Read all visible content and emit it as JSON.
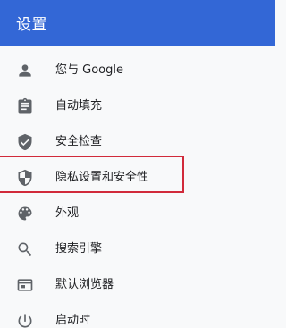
{
  "header": {
    "title": "设置"
  },
  "menu": {
    "items": [
      {
        "label": "您与 Google",
        "icon": "person-icon"
      },
      {
        "label": "自动填充",
        "icon": "clipboard-icon"
      },
      {
        "label": "安全检查",
        "icon": "shield-check-icon"
      },
      {
        "label": "隐私设置和安全性",
        "icon": "shield-half-icon"
      },
      {
        "label": "外观",
        "icon": "palette-icon"
      },
      {
        "label": "搜索引擎",
        "icon": "search-icon"
      },
      {
        "label": "默认浏览器",
        "icon": "browser-window-icon"
      },
      {
        "label": "启动时",
        "icon": "power-icon"
      }
    ],
    "highlighted_item": "隐私设置和安全性"
  },
  "colors": {
    "header_bg": "#3367d6",
    "page_bg": "#f8f9fa",
    "icon": "#5f6368",
    "text": "#202124",
    "highlight_border": "#d12a3a"
  }
}
